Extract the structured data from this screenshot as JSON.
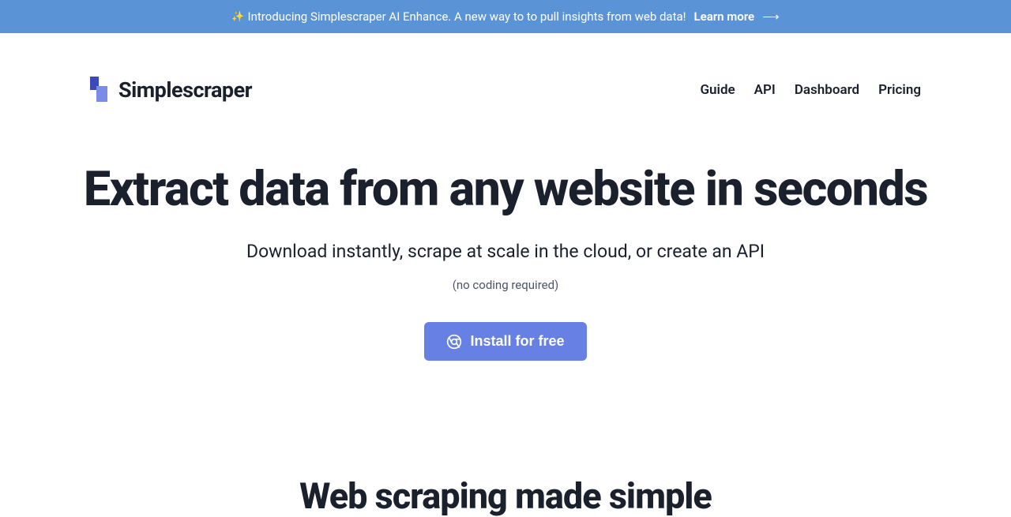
{
  "announcement": {
    "sparkle": "✨",
    "text": "Introducing Simplescraper AI Enhance. A new way to to pull insights from web data!",
    "learn_more": "Learn more",
    "arrow": "⟶"
  },
  "logo": {
    "text": "Simplescraper"
  },
  "nav": {
    "guide": "Guide",
    "api": "API",
    "dashboard": "Dashboard",
    "pricing": "Pricing"
  },
  "hero": {
    "title": "Extract data from any website in seconds",
    "subtitle": "Download instantly, scrape at scale in the cloud, or create an API",
    "note": "(no coding required)",
    "cta": "Install for free"
  },
  "section": {
    "title": "Web scraping made simple"
  },
  "colors": {
    "announcement_bg": "#5a94d6",
    "cta_bg": "#6680e3",
    "logo_dark": "#3b4ab8",
    "logo_light": "#7a8ce8"
  }
}
